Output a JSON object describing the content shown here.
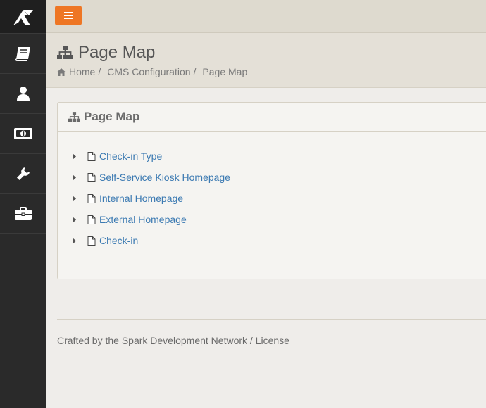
{
  "sidebar": {
    "logo_icon": "rock-logo-icon",
    "items": [
      {
        "icon": "book-icon"
      },
      {
        "icon": "user-icon"
      },
      {
        "icon": "money-icon"
      },
      {
        "icon": "wrench-icon"
      },
      {
        "icon": "briefcase-icon"
      }
    ]
  },
  "topbar": {
    "menu_icon": "hamburger-icon",
    "accent": "#ee7624"
  },
  "header": {
    "title": "Page Map",
    "breadcrumb": [
      {
        "label": "Home"
      },
      {
        "label": "CMS Configuration"
      },
      {
        "label": "Page Map"
      }
    ],
    "separator": "/"
  },
  "panel": {
    "title": "Page Map",
    "items": [
      {
        "label": "Check-in Type"
      },
      {
        "label": "Self-Service Kiosk Homepage"
      },
      {
        "label": "Internal Homepage"
      },
      {
        "label": "External Homepage"
      },
      {
        "label": "Check-in"
      }
    ]
  },
  "footer": {
    "text": "Crafted by the Spark Development Network / License"
  },
  "colors": {
    "link": "#3c7ab2",
    "sidebar": "#2a2a2a",
    "header_bg": "#e4e0d7"
  }
}
